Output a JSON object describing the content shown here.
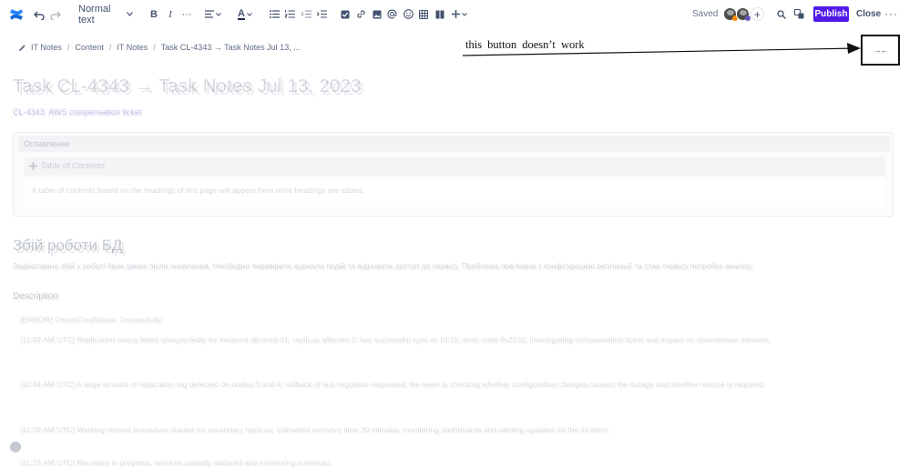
{
  "toolbar": {
    "text_style": "Normal text",
    "saved": "Saved",
    "publish": "Publish",
    "close": "Close",
    "more": "···"
  },
  "breadcrumb": {
    "items": [
      "IT Notes",
      "Content",
      "IT Notes",
      "Task CL-4343 → Task Notes Jul 13, ..."
    ]
  },
  "annotation": {
    "text": "this button doesn’t work",
    "button_glyph": "→←"
  },
  "page": {
    "title": "Task CL-4343 → Task Notes Jul 13, 2023",
    "link": "CL-4343: AWS compensation ticket",
    "toc_panel_title": "Оглавление",
    "toc_inner_title": "Table of Contents",
    "toc_body": "A table of contents based on the headings of this page will appear here once headings are added.",
    "section_heading": "Збій роботи БД",
    "section_desc": "Зафіксовано збій у роботі бази даних після оновлення. Необхідно перевірити журнали подій та відновити доступ до сервісу. Проблема пов’язана з конфігурацією реплікації та стан сервісу потребує аналізу.",
    "description_heading": "Description",
    "paragraphs": [
      "[ERROR] CheckCredStatus: Connectivity",
      "[11:02 AM UTC] Replication status failed unexpectedly for instance db-prod-01; replicas affected 2; last successful sync at 10:31; error code 0x2231; investigating compensation ticket and impact on downstream services.",
      "[11:04 AM UTC] A large amount of replication lag detected on nodes 3 and 4; rollback of last migration requested; the team is checking whether configuration changes caused the outage and whether restore is required.",
      "[11:09 AM UTC] Working restore procedure started for secondary replicas; estimated recovery time 20 minutes; monitoring dashboards and alerting updated for the incident.",
      "[11:15 AM UTC] Recovery in progress; services partially restored and monitoring continues."
    ]
  }
}
